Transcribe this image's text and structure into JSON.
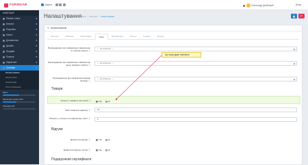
{
  "brand": {
    "name": "FORMSAB"
  },
  "topbar": {
    "nav": [
      "Додати",
      "Замовлення",
      "Магазин"
    ],
    "user": "Олександр Дембіцкий",
    "lang": "Українська",
    "logout": "Вихід",
    "badge": "1"
  },
  "sidebar": {
    "header": "НАВІГАЦІЯ",
    "items": [
      {
        "label": "Панель стану"
      },
      {
        "label": "Каталог"
      },
      {
        "label": "Розробки"
      },
      {
        "label": "Бізнес"
      },
      {
        "label": "Доповнення"
      },
      {
        "label": "Дизайн"
      },
      {
        "label": "Продажі"
      },
      {
        "label": "Покупці"
      },
      {
        "label": "Маркетинг"
      },
      {
        "label": "Система"
      }
    ],
    "subitems": [
      "Налаштування",
      "Користувачі",
      "Локалізація",
      "Обслуговування"
    ],
    "active_index": 9,
    "active_sub": 0,
    "stats": [
      {
        "label": "Звіти",
        "value": 0.5
      },
      {
        "label": "Захисний період 42%",
        "value": 0.42
      },
      {
        "label": "Обробка 0%",
        "value": 0.0
      }
    ]
  },
  "page": {
    "title": "Налаштування",
    "breadcrumbs": [
      "Головна",
      "Магазини",
      "Налаштування"
    ],
    "save_icon": "save-icon",
    "cancel_icon": "reply-icon"
  },
  "panel": {
    "heading": "Налаштування",
    "tabs": [
      "Загальні",
      "Магазин",
      "Локалізація",
      "Опції",
      "Зображення",
      "Пошта",
      "Сервер",
      "Шлюзи"
    ],
    "active_tab": 3
  },
  "fields": {
    "f1": {
      "label": "Підтвердження при оформленні замовлення зі сторони клієнта",
      "value": "--- Не вибрано ---"
    },
    "f2": {
      "label": "Підтвердження при оформленні замовлення через зіркового клієнта",
      "value": "--- Не вибрано ---"
    },
    "f3": {
      "label": "Підтвердження при оформленні форми безпеки",
      "value": "--- Не вибрано ---"
    },
    "section_products": "Товари",
    "f4": {
      "label": "Кількість товарів в категоріях",
      "yes": "Так",
      "no": "Ні"
    },
    "f5": {
      "label": "Ліміт знижок (в адмінці)",
      "value": "10"
    },
    "f6": {
      "label": "Кількість у списку в оглядальному тексті",
      "value": "5"
    },
    "section_reviews": "Відгуки",
    "f7": {
      "label": "Дозволити відгуки",
      "yes": "Так",
      "no": "Ні"
    },
    "f8": {
      "label": "Дозволити відгуки гостям",
      "yes": "Так",
      "no": "Ні"
    },
    "section_vouchers": "Подарункові сертифікати"
  },
  "tooltip": {
    "text": "Ця опція дуже повільна!"
  }
}
